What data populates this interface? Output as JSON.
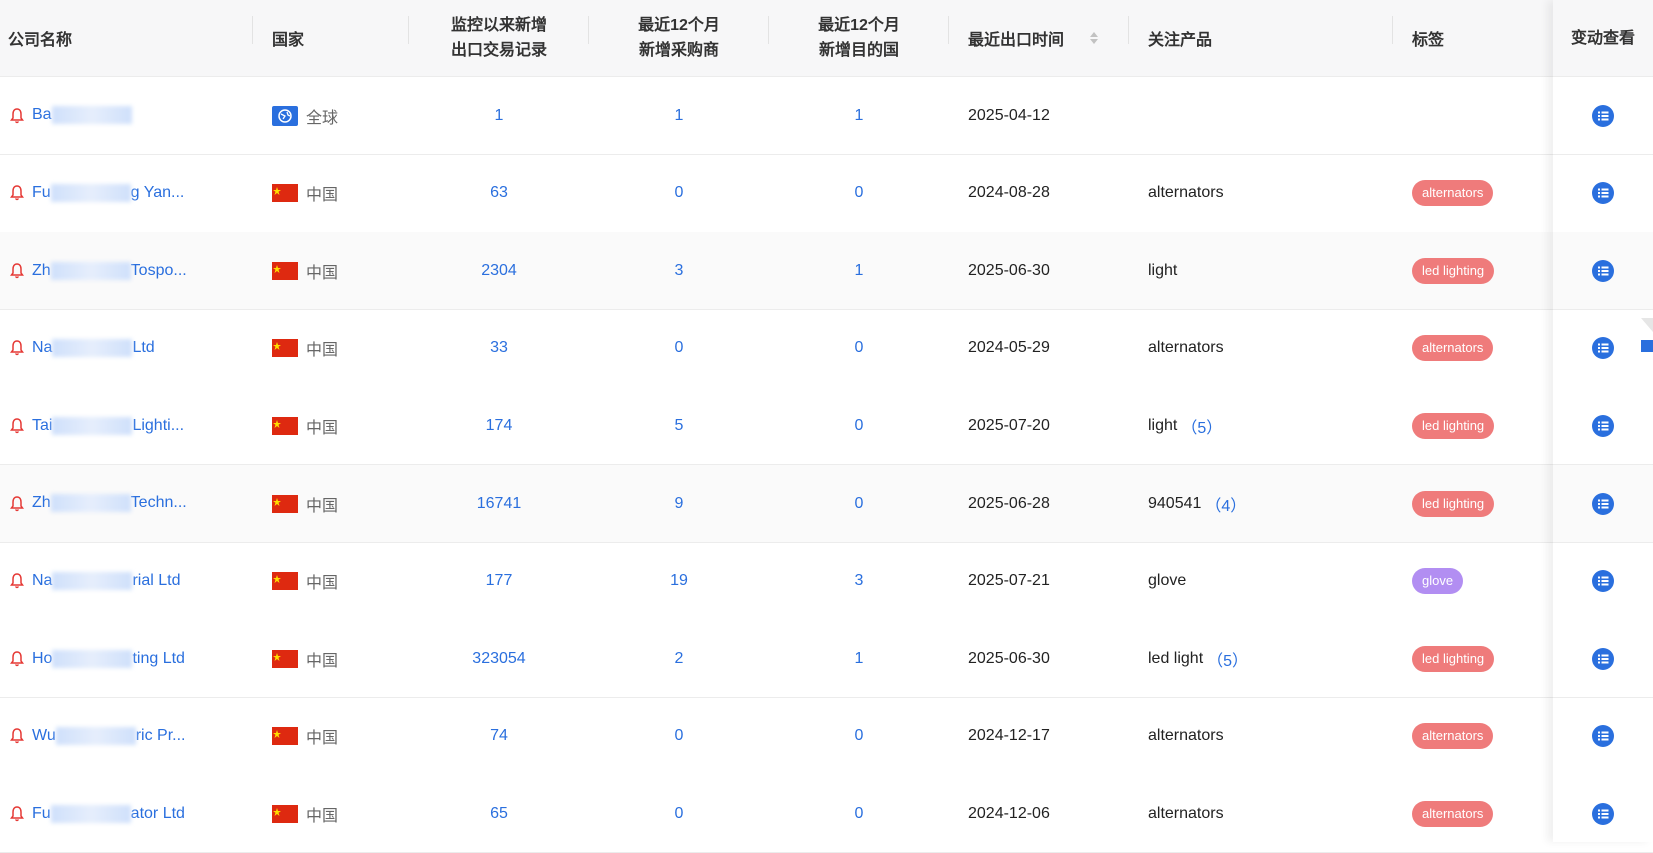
{
  "columns": {
    "company": "公司名称",
    "country": "国家",
    "new_records_line1": "监控以来新增",
    "new_records_line2": "出口交易记录",
    "buyers_line1": "最近12个月",
    "buyers_line2": "新增采购商",
    "dest_line1": "最近12个月",
    "dest_line2": "新增目的国",
    "last_export": "最近出口时间",
    "product": "关注产品",
    "tag": "标签",
    "view": "变动查看"
  },
  "colors": {
    "alternators": "#ef7b7b",
    "led_lighting": "#ef7b7b",
    "glove": "#b28ef2",
    "accent": "#2a6fde"
  },
  "rows": [
    {
      "company_prefix": "Ba",
      "company_suffix": "",
      "country": "全球",
      "flag": "globe",
      "records": "1",
      "buyers": "1",
      "dest": "1",
      "date": "2025-04-12",
      "product": "",
      "product_count": "",
      "tag": "",
      "tag_color": ""
    },
    {
      "company_prefix": "Fu",
      "company_suffix": "g Yan...",
      "country": "中国",
      "flag": "cn",
      "records": "63",
      "buyers": "0",
      "dest": "0",
      "date": "2024-08-28",
      "product": "alternators",
      "product_count": "",
      "tag": "alternators",
      "tag_color": "#ef7b7b"
    },
    {
      "company_prefix": "Zh",
      "company_suffix": "Tospo...",
      "country": "中国",
      "flag": "cn",
      "records": "2304",
      "buyers": "3",
      "dest": "1",
      "date": "2025-06-30",
      "product": "light",
      "product_count": "",
      "tag": "led lighting",
      "tag_color": "#ef7b7b"
    },
    {
      "company_prefix": "Na",
      "company_suffix": "Ltd",
      "country": "中国",
      "flag": "cn",
      "records": "33",
      "buyers": "0",
      "dest": "0",
      "date": "2024-05-29",
      "product": "alternators",
      "product_count": "",
      "tag": "alternators",
      "tag_color": "#ef7b7b"
    },
    {
      "company_prefix": "Tai",
      "company_suffix": "Lighti...",
      "country": "中国",
      "flag": "cn",
      "records": "174",
      "buyers": "5",
      "dest": "0",
      "date": "2025-07-20",
      "product": "light",
      "product_count": "（5）",
      "tag": "led lighting",
      "tag_color": "#ef7b7b"
    },
    {
      "company_prefix": "Zh",
      "company_suffix": "Techn...",
      "country": "中国",
      "flag": "cn",
      "records": "16741",
      "buyers": "9",
      "dest": "0",
      "date": "2025-06-28",
      "product": "940541",
      "product_count": "（4）",
      "tag": "led lighting",
      "tag_color": "#ef7b7b"
    },
    {
      "company_prefix": "Na",
      "company_suffix": "rial Ltd",
      "country": "中国",
      "flag": "cn",
      "records": "177",
      "buyers": "19",
      "dest": "3",
      "date": "2025-07-21",
      "product": "glove",
      "product_count": "",
      "tag": "glove",
      "tag_color": "#b28ef2"
    },
    {
      "company_prefix": "Ho",
      "company_suffix": "ting Ltd",
      "country": "中国",
      "flag": "cn",
      "records": "323054",
      "buyers": "2",
      "dest": "1",
      "date": "2025-06-30",
      "product": "led light",
      "product_count": "（5）",
      "tag": "led lighting",
      "tag_color": "#ef7b7b"
    },
    {
      "company_prefix": "Wu",
      "company_suffix": "ric Pr...",
      "country": "中国",
      "flag": "cn",
      "records": "74",
      "buyers": "0",
      "dest": "0",
      "date": "2024-12-17",
      "product": "alternators",
      "product_count": "",
      "tag": "alternators",
      "tag_color": "#ef7b7b"
    },
    {
      "company_prefix": "Fu",
      "company_suffix": "ator Ltd",
      "country": "中国",
      "flag": "cn",
      "records": "65",
      "buyers": "0",
      "dest": "0",
      "date": "2024-12-06",
      "product": "alternators",
      "product_count": "",
      "tag": "alternators",
      "tag_color": "#ef7b7b"
    }
  ]
}
